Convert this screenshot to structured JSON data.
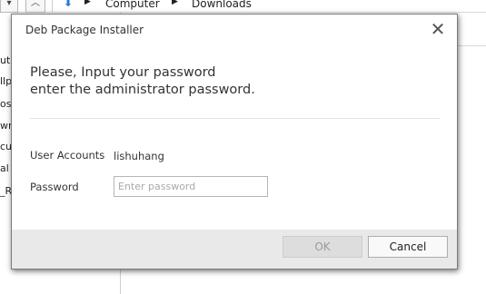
{
  "background": {
    "toolbar": {
      "dropdown_glyph": "▾",
      "up_glyph": "︿",
      "download_glyph": "⬇",
      "breadcrumbs": [
        "Computer",
        "Downloads"
      ],
      "crumb_arrow": "▶"
    },
    "sidebar_fragments": [
      "ut",
      "llp",
      "os",
      "wn",
      "cur",
      "al",
      "_R"
    ]
  },
  "dialog": {
    "title": "Deb Package Installer",
    "close_glyph": "✕",
    "heading_line1": "Please, Input your password",
    "heading_line2": "enter the administrator password.",
    "user_accounts_label": "User Accounts",
    "user_accounts_value": "lishuhang",
    "password_label": "Password",
    "password_value": "",
    "password_placeholder": "Enter password",
    "ok_label": "OK",
    "cancel_label": "Cancel"
  },
  "colors": {
    "accent_download": "#2d7ad6",
    "footer_bg": "#e9e9e9",
    "ok_disabled_bg": "#dddddd"
  }
}
